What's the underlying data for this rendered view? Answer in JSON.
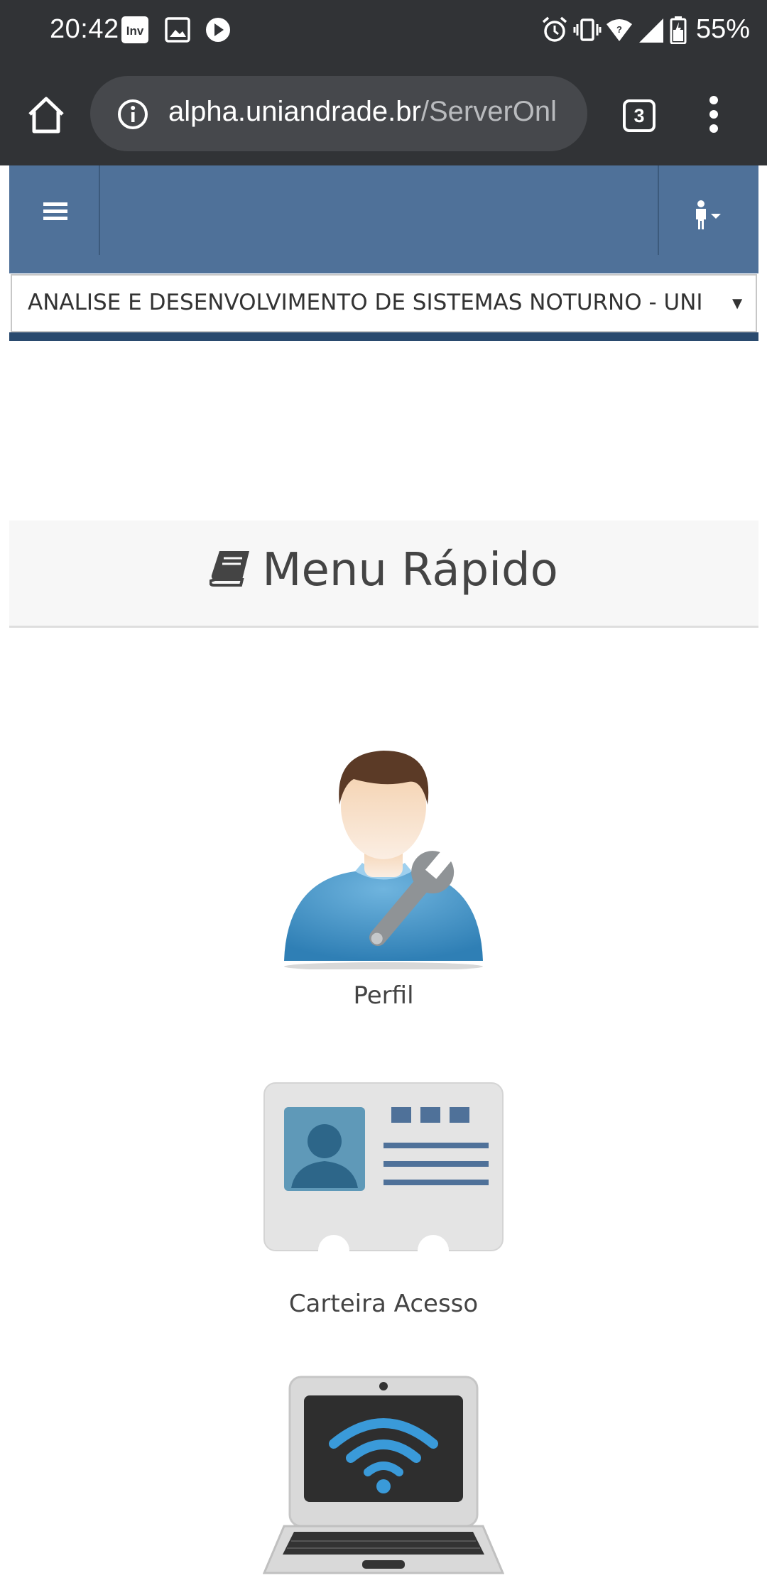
{
  "status_bar": {
    "time": "20:42",
    "battery": "55%"
  },
  "browser": {
    "url_host": "alpha.uniandrade.br",
    "url_path": "/ServerOnl",
    "tab_count": "3"
  },
  "course_select": {
    "selected": "ANALISE E DESENVOLVIMENTO DE SISTEMAS NOTURNO - UNI"
  },
  "quick_menu": {
    "title": "Menu Rápido",
    "items": [
      {
        "label": "Perfil",
        "icon": "profile-settings-icon"
      },
      {
        "label": "Carteira Acesso",
        "icon": "id-card-icon"
      },
      {
        "label": "",
        "icon": "laptop-wifi-icon"
      }
    ]
  },
  "colors": {
    "status_bar_bg": "#313336",
    "nav_header_bg": "#4f7199",
    "url_bar_bg": "#46484c"
  }
}
